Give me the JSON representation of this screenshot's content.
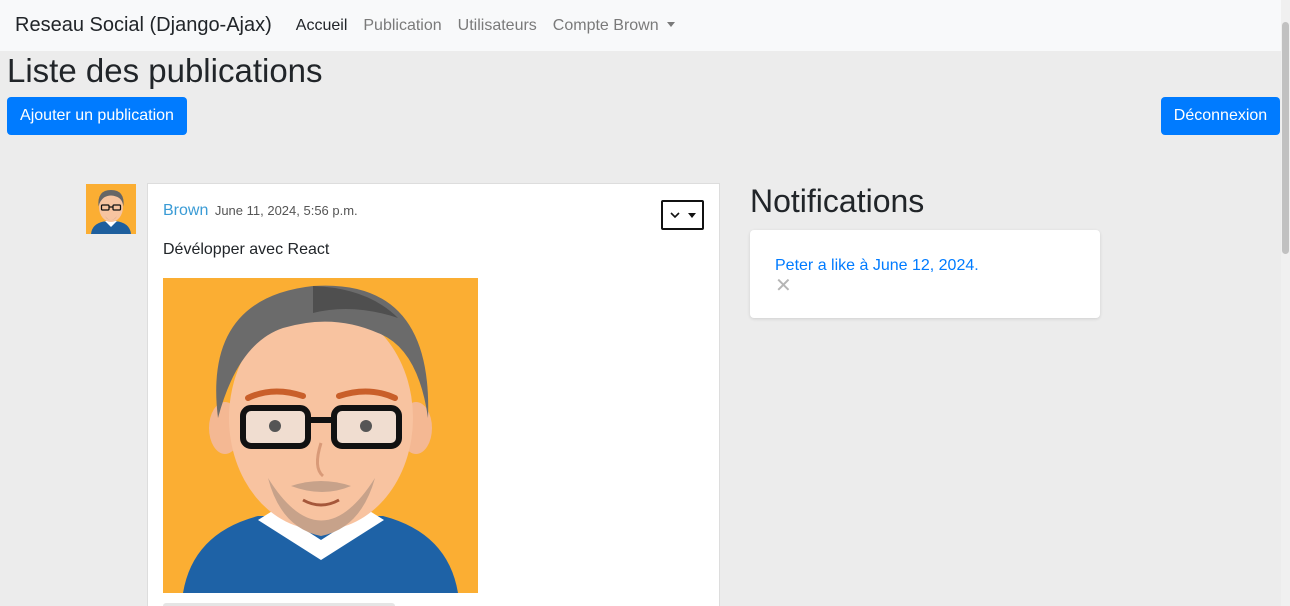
{
  "navbar": {
    "brand": "Reseau Social (Django-Ajax)",
    "links": [
      {
        "label": "Accueil"
      },
      {
        "label": "Publication"
      },
      {
        "label": "Utilisateurs"
      },
      {
        "label": "Compte Brown"
      }
    ]
  },
  "page": {
    "title": "Liste des publications",
    "add_button": "Ajouter un publication",
    "logout_button": "Déconnexion"
  },
  "post": {
    "author": "Brown",
    "date": "June 11, 2024, 5:56 p.m.",
    "text": "Dévélopper avec React",
    "menu_icon": "chevron-down-icon"
  },
  "notifications": {
    "title": "Notifications",
    "items": [
      {
        "text": "Peter a like à June 12, 2024."
      }
    ]
  },
  "colors": {
    "primary": "#007bff",
    "author": "#3a9bd5",
    "avatar_bg": "#fbae33"
  }
}
